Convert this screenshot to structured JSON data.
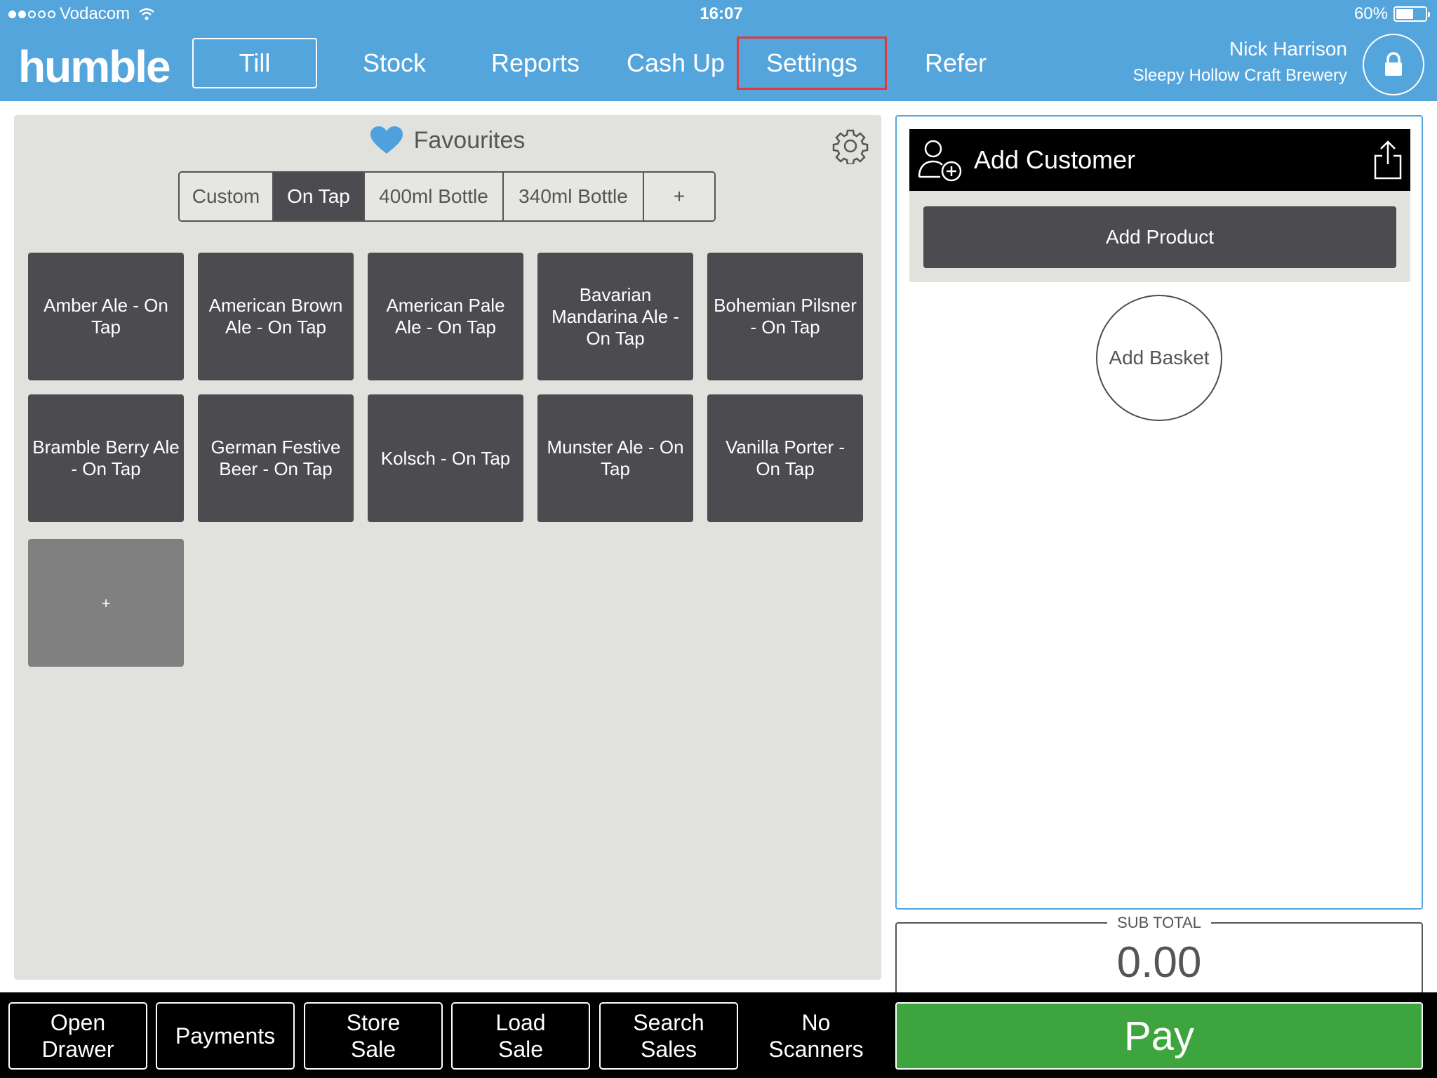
{
  "status_bar": {
    "carrier": "Vodacom",
    "signal_bars_filled": 2,
    "signal_bars_total": 5,
    "time": "16:07",
    "battery": "60%",
    "battery_level": 0.6
  },
  "nav": {
    "logo": "humble",
    "items": [
      {
        "label": "Till"
      },
      {
        "label": "Stock"
      },
      {
        "label": "Reports"
      },
      {
        "label": "Cash Up"
      },
      {
        "label": "Settings"
      },
      {
        "label": "Refer"
      }
    ],
    "active": "Till",
    "highlighted": "Settings",
    "user_name": "Nick Harrison",
    "store_name": "Sleepy Hollow Craft Brewery"
  },
  "favourites": {
    "title": "Favourites",
    "tabs": [
      {
        "label": "Custom"
      },
      {
        "label": "On Tap"
      },
      {
        "label": "400ml Bottle"
      },
      {
        "label": "340ml Bottle"
      },
      {
        "label": "+"
      }
    ],
    "active_tab": "On Tap",
    "products": [
      {
        "label": "Amber Ale - On Tap"
      },
      {
        "label": "American Brown Ale - On Tap"
      },
      {
        "label": "American Pale Ale - On Tap"
      },
      {
        "label": "Bavarian Mandarina Ale - On Tap"
      },
      {
        "label": "Bohemian Pilsner - On Tap"
      },
      {
        "label": "Bramble Berry Ale - On Tap"
      },
      {
        "label": "German Festive Beer - On Tap"
      },
      {
        "label": "Kolsch - On Tap"
      },
      {
        "label": "Munster Ale - On Tap"
      },
      {
        "label": "Vanilla Porter - On Tap"
      }
    ],
    "add_tile": "+"
  },
  "cart": {
    "add_customer": "Add Customer",
    "add_product": "Add Product",
    "add_basket": "Add Basket",
    "subtotal_label": "SUB TOTAL",
    "subtotal_value": "0.00"
  },
  "bottom": {
    "buttons": [
      {
        "label": "Open\nDrawer"
      },
      {
        "label": "Payments"
      },
      {
        "label": "Store\nSale"
      },
      {
        "label": "Load\nSale"
      },
      {
        "label": "Search\nSales"
      },
      {
        "label": "No\nScanners"
      }
    ],
    "pay": "Pay"
  },
  "colors": {
    "brand_blue": "#55a5dd",
    "tile_dark": "#4b4b50",
    "pay_green": "#3ea53e",
    "highlight_red": "#e53935",
    "heart_blue": "#4ea1dc"
  }
}
